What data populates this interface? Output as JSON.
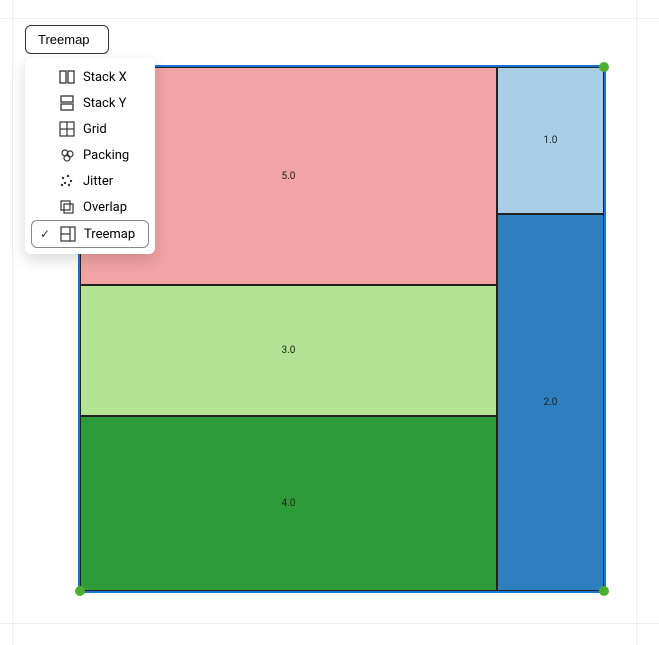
{
  "dropdown": {
    "button_label": "Treemap",
    "options": [
      {
        "label": "Stack X"
      },
      {
        "label": "Stack Y"
      },
      {
        "label": "Grid"
      },
      {
        "label": "Packing"
      },
      {
        "label": "Jitter"
      },
      {
        "label": "Overlap"
      },
      {
        "label": "Treemap"
      }
    ],
    "selected_index": 6
  },
  "chart_data": {
    "type": "treemap",
    "title": "",
    "nodes": [
      {
        "label": "5.0",
        "value": 5.0,
        "color": "#f2a3a3"
      },
      {
        "label": "3.0",
        "value": 3.0,
        "color": "#b3e495"
      },
      {
        "label": "4.0",
        "value": 4.0,
        "color": "#2e9b3a"
      },
      {
        "label": "1.0",
        "value": 1.0,
        "color": "#a9cfe8"
      },
      {
        "label": "2.0",
        "value": 2.0,
        "color": "#2d7fc0"
      }
    ]
  }
}
